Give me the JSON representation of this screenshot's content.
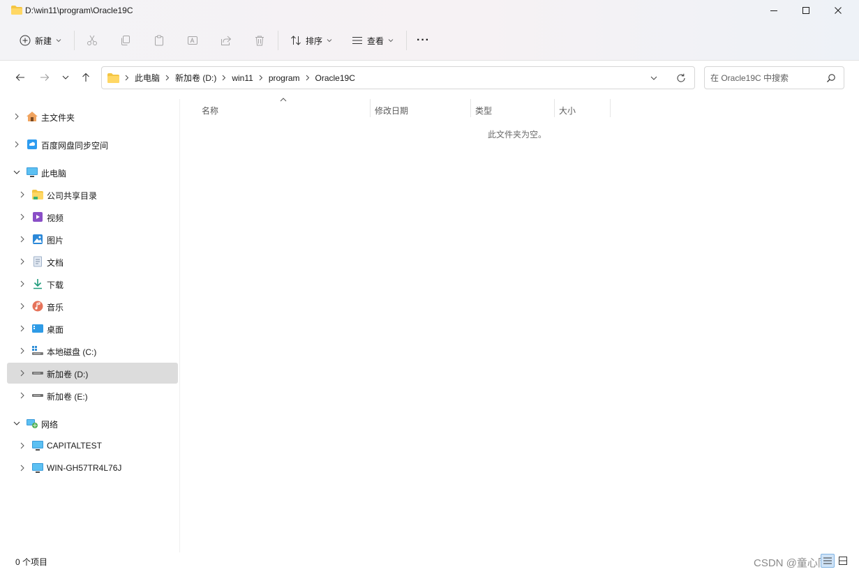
{
  "window": {
    "title": "D:\\win11\\program\\Oracle19C"
  },
  "toolbar": {
    "new_label": "新建",
    "sort_label": "排序",
    "view_label": "查看",
    "more_label": "···"
  },
  "address": {
    "crumbs": [
      "此电脑",
      "新加卷 (D:)",
      "win11",
      "program",
      "Oracle19C"
    ]
  },
  "search": {
    "placeholder": "在 Oracle19C 中搜索"
  },
  "sidebar": {
    "items": [
      {
        "label": "主文件夹"
      },
      {
        "label": "百度网盘同步空间"
      },
      {
        "label": "此电脑"
      },
      {
        "label": "公司共享目录"
      },
      {
        "label": "视频"
      },
      {
        "label": "图片"
      },
      {
        "label": "文档"
      },
      {
        "label": "下载"
      },
      {
        "label": "音乐"
      },
      {
        "label": "桌面"
      },
      {
        "label": "本地磁盘 (C:)"
      },
      {
        "label": "新加卷 (D:)"
      },
      {
        "label": "新加卷 (E:)"
      },
      {
        "label": "网络"
      },
      {
        "label": "CAPITALTEST"
      },
      {
        "label": "WIN-GH57TR4L76J"
      }
    ],
    "selected": "新加卷 (D:)"
  },
  "content": {
    "columns": [
      "名称",
      "修改日期",
      "类型",
      "大小"
    ],
    "empty_message": "此文件夹为空。"
  },
  "status": {
    "item_count": "0 个项目",
    "watermark": "CSDN @童心同"
  },
  "colors": {
    "folder_yellow": "#f4c542",
    "selected_bg": "#dcdcdc",
    "accent_blue": "#0078d4"
  }
}
